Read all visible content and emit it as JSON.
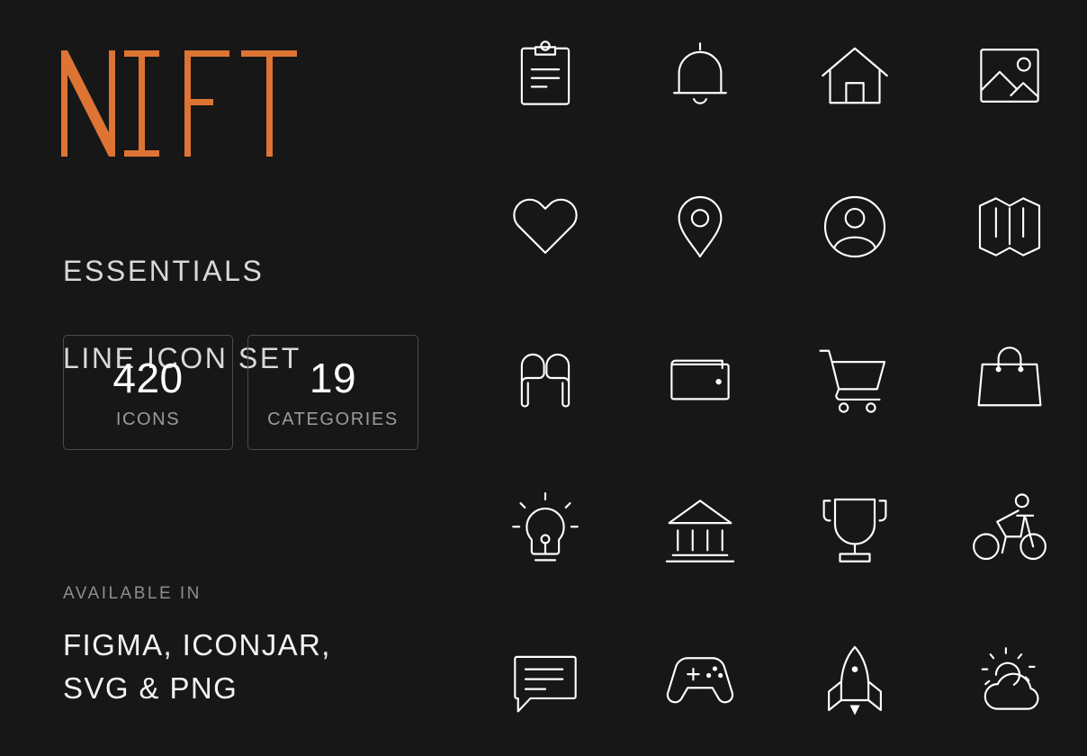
{
  "background_color": "#171717",
  "accent_color": "#DD7434",
  "text_color": "#D9D9D9",
  "muted_color": "#8E8E8E",
  "icon_color": "#FFFFFF",
  "brand": {
    "name": "NIFT",
    "letters": [
      "N",
      "I",
      "F",
      "T"
    ]
  },
  "tagline": {
    "line1": "ESSENTIALS",
    "line2": "LINE ICON SET"
  },
  "stats": [
    {
      "value": "420",
      "label": "ICONS"
    },
    {
      "value": "19",
      "label": "CATEGORIES"
    }
  ],
  "availability": {
    "label": "AVAILABLE IN",
    "line1": "FIGMA, ICONJAR,",
    "line2": "SVG & PNG"
  },
  "icon_grid": {
    "columns": 4,
    "rows": 5,
    "icons": [
      {
        "name": "clipboard-icon",
        "label": "Clipboard"
      },
      {
        "name": "bell-icon",
        "label": "Bell"
      },
      {
        "name": "home-icon",
        "label": "Home"
      },
      {
        "name": "image-icon",
        "label": "Image"
      },
      {
        "name": "heart-icon",
        "label": "Heart"
      },
      {
        "name": "map-pin-icon",
        "label": "Map Pin"
      },
      {
        "name": "user-circle-icon",
        "label": "User"
      },
      {
        "name": "folded-map-icon",
        "label": "Map"
      },
      {
        "name": "earbuds-icon",
        "label": "Earbuds"
      },
      {
        "name": "wallet-icon",
        "label": "Wallet"
      },
      {
        "name": "shopping-cart-icon",
        "label": "Shopping Cart"
      },
      {
        "name": "shopping-bag-icon",
        "label": "Shopping Bag"
      },
      {
        "name": "lightbulb-icon",
        "label": "Lightbulb"
      },
      {
        "name": "bank-icon",
        "label": "Bank"
      },
      {
        "name": "trophy-icon",
        "label": "Trophy"
      },
      {
        "name": "bicycle-icon",
        "label": "Bicycle"
      },
      {
        "name": "chat-bubble-icon",
        "label": "Chat"
      },
      {
        "name": "gamepad-icon",
        "label": "Gamepad"
      },
      {
        "name": "rocket-icon",
        "label": "Rocket"
      },
      {
        "name": "partly-cloudy-icon",
        "label": "Weather"
      }
    ]
  }
}
